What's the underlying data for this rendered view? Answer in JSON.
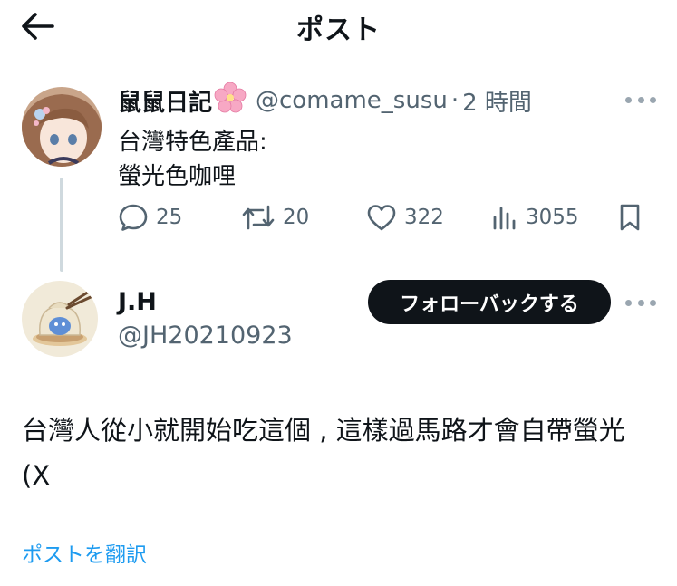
{
  "header": {
    "title": "ポスト",
    "back_icon": "arrow-left-icon"
  },
  "parent_post": {
    "display_name": "鼠鼠日記",
    "name_emoji": "🌸",
    "handle": "@comame_susu",
    "separator": "·",
    "time": "2 時間",
    "text_lines": [
      "台灣特色產品:",
      "螢光色咖哩"
    ],
    "actions": {
      "replies": "25",
      "reposts": "20",
      "likes": "322",
      "views": "3055"
    }
  },
  "reply": {
    "display_name": "J.H",
    "handle": "@JH20210923",
    "follow_button": "フォローバックする",
    "text": "台灣人從小就開始吃這個 , 這樣過馬路才會自帶螢光 (X",
    "translate_link": "ポストを翻訳"
  },
  "colors": {
    "text": "#0f1419",
    "secondary": "#536471",
    "link": "#1d9bf0",
    "thread_line": "#cfd9de",
    "button_bg": "#0f1419"
  }
}
